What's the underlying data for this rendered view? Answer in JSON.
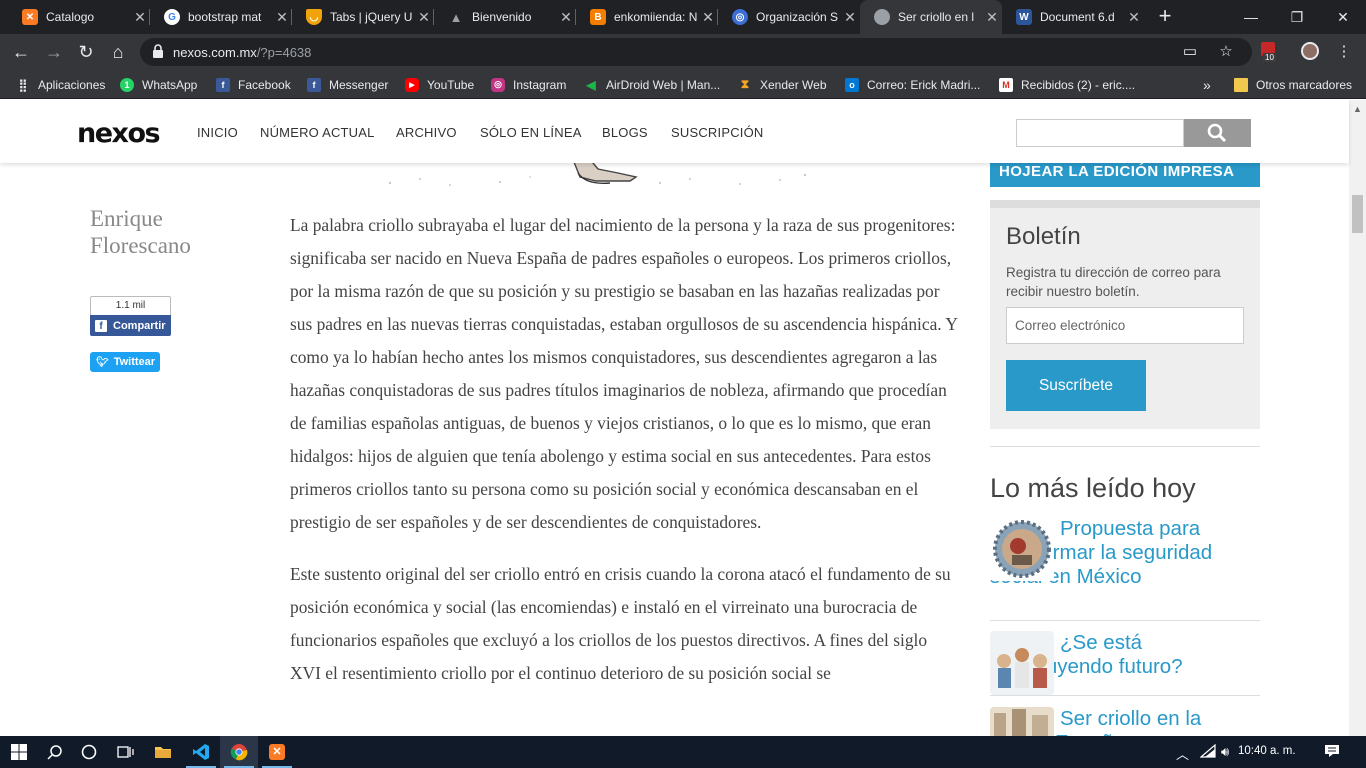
{
  "browser": {
    "tabs": [
      {
        "title": "Catalogo",
        "favicon": "xampp-icon",
        "color": "#fb7a24"
      },
      {
        "title": "bootstrap mat",
        "favicon": "google-icon",
        "color": "#ffffff"
      },
      {
        "title": "Tabs | jQuery U",
        "favicon": "shield-icon",
        "color": "#f0a30a"
      },
      {
        "title": "Bienvenido",
        "favicon": "batman-icon",
        "color": "#202124"
      },
      {
        "title": "enkomiienda: N",
        "favicon": "blogger-icon",
        "color": "#f57d00"
      },
      {
        "title": "Organización S",
        "favicon": "globe-icon",
        "color": "#3b6fd6"
      },
      {
        "title": "Ser criollo en l",
        "favicon": "globe-icon",
        "color": "#9aa0a6",
        "active": true
      },
      {
        "title": "Document 6.d",
        "favicon": "word-icon",
        "color": "#2b579a"
      }
    ],
    "new_tab": "+",
    "window_controls": {
      "minimize": "—",
      "restore": "❐",
      "close": "✕"
    },
    "url_host": "nexos.com.mx",
    "url_path": "/?p=4638",
    "extension_badge": "10",
    "bookmarks": [
      {
        "label": "Aplicaciones",
        "icon": "apps-grid-icon",
        "color": "#e8eaed"
      },
      {
        "label": "WhatsApp",
        "icon": "whatsapp-icon",
        "color": "#25d366"
      },
      {
        "label": "Facebook",
        "icon": "facebook-icon",
        "color": "#3b5998"
      },
      {
        "label": "Messenger",
        "icon": "facebook-icon",
        "color": "#3b5998"
      },
      {
        "label": "YouTube",
        "icon": "youtube-icon",
        "color": "#ff0000"
      },
      {
        "label": "Instagram",
        "icon": "instagram-icon",
        "color": "#c13584"
      },
      {
        "label": "AirDroid Web | Man...",
        "icon": "airdroid-icon",
        "color": "#1cb847"
      },
      {
        "label": "Xender Web",
        "icon": "xender-icon",
        "color": "#f5a623"
      },
      {
        "label": "Correo: Erick Madri...",
        "icon": "outlook-icon",
        "color": "#0078d4"
      },
      {
        "label": "Recibidos (2) - eric....",
        "icon": "gmail-icon",
        "color": "#d93025"
      }
    ],
    "bookmarks_overflow": "»",
    "other_bookmarks": "Otros marcadores"
  },
  "site": {
    "logo": "nexos",
    "nav": [
      "INICIO",
      "NÚMERO ACTUAL",
      "ARCHIVO",
      "SÓLO EN LÍNEA",
      "BLOGS",
      "SUSCRIPCIÓN"
    ]
  },
  "article": {
    "author": "Enrique Florescano",
    "fb_count": "1.1 mil",
    "fb_label": "Compartir",
    "tweet_label": "Twittear",
    "paragraphs": [
      "La palabra criollo subrayaba el lugar del nacimiento de la persona y la raza de sus progenitores: significaba ser nacido en Nueva España de padres españoles o europeos. Los primeros criollos, por la misma razón de que su posición y su prestigio se basaban en las hazañas realizadas por sus padres en las nuevas tierras conquistadas, estaban orgullosos de su ascendencia hispánica. Y como ya lo habían hecho antes los mismos conquistadores, sus descendientes agregaron a las hazañas conquistadoras de sus padres títulos imaginarios de nobleza, afirmando que procedían de familias españolas antiguas, de buenos y viejos cristianos, o lo que es lo mismo, que eran hidalgos: hijos de alguien que tenía abolengo y estima social en sus antecedentes. Para estos primeros criollos tanto su persona como su posición social y económica descansaban en el prestigio de ser españoles y de ser descendientes de conquistadores.",
      "Este sustento original del ser criollo entró en crisis cuando la corona atacó el fundamento de su posición económica y social (las encomiendas) e instaló en el virreinato una burocracia de funcionarios españoles que excluyó a los criollos de los puestos directivos. A fines del siglo XVI el resentimiento criollo por el continuo deterioro de su posición social se"
    ]
  },
  "sidebar": {
    "hojear": "HOJEAR LA EDICIÓN IMPRESA",
    "boletin_title": "Boletín",
    "boletin_desc": "Registra tu dirección de correo para recibir nuestro boletín.",
    "email_placeholder": "Correo electrónico",
    "subscribe": "Suscríbete",
    "mas_leido": "Lo más leído hoy",
    "items": [
      {
        "title": "Propuesta para transformar la seguridad social en México"
      },
      {
        "title": "¿Se está construyendo futuro?"
      },
      {
        "title": "Ser criollo en la Nueva España"
      }
    ]
  },
  "taskbar": {
    "clock": "10:40 a. m.",
    "apps": [
      "windows-start-icon",
      "search-icon",
      "cortana-icon",
      "task-view-icon",
      "file-explorer-icon",
      "vscode-icon",
      "chrome-icon",
      "xampp-icon"
    ]
  },
  "colors": {
    "accent": "#2899c9",
    "chrome_dark": "#202124",
    "chrome_toolbar": "#35363a",
    "taskbar": "#101a28"
  }
}
